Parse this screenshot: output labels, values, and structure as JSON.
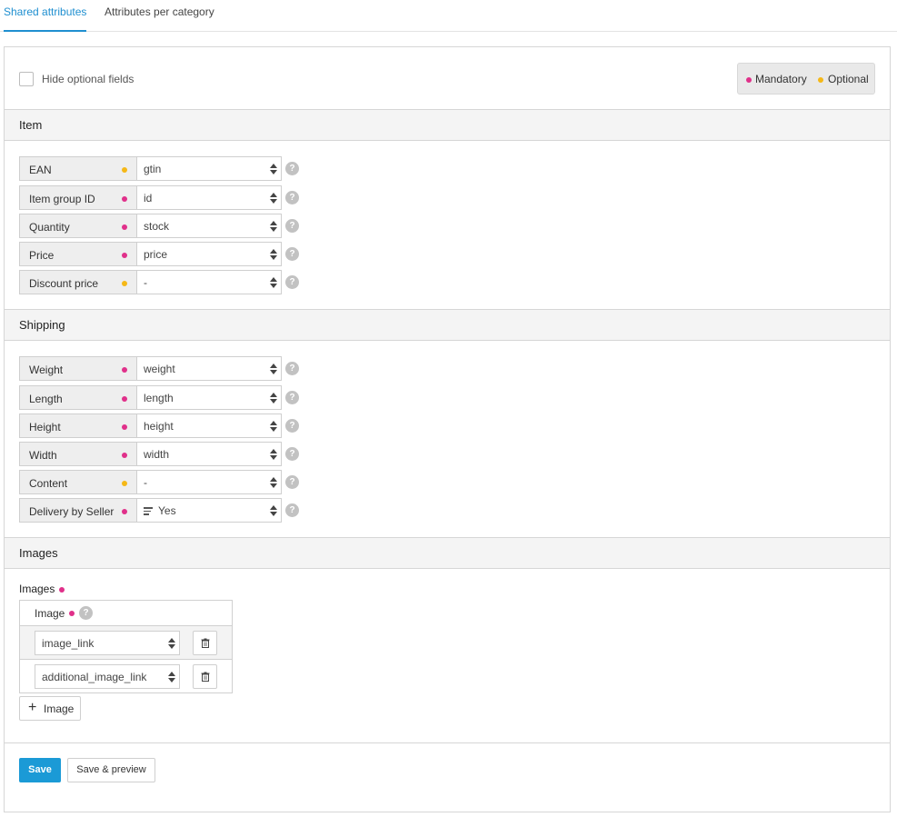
{
  "tabs": [
    {
      "label": "Shared attributes",
      "active": true
    },
    {
      "label": "Attributes per category",
      "active": false
    }
  ],
  "hide_optional": {
    "label": "Hide optional fields",
    "checked": false
  },
  "legend": {
    "mandatory": "Mandatory",
    "optional": "Optional"
  },
  "colors": {
    "mandatory": "#e0308a",
    "optional": "#f5b817",
    "accent": "#1b9ad6"
  },
  "sections": {
    "item": {
      "title": "Item",
      "rows": [
        {
          "label": "EAN",
          "status": "optional",
          "value": "gtin"
        },
        {
          "label": "Item group ID",
          "status": "mandatory",
          "value": "id"
        },
        {
          "label": "Quantity",
          "status": "mandatory",
          "value": "stock"
        },
        {
          "label": "Price",
          "status": "mandatory",
          "value": "price"
        },
        {
          "label": "Discount price",
          "status": "optional",
          "value": "-"
        }
      ]
    },
    "shipping": {
      "title": "Shipping",
      "rows": [
        {
          "label": "Weight",
          "status": "mandatory",
          "value": "weight"
        },
        {
          "label": "Length",
          "status": "mandatory",
          "value": "length"
        },
        {
          "label": "Height",
          "status": "mandatory",
          "value": "height"
        },
        {
          "label": "Width",
          "status": "mandatory",
          "value": "width"
        },
        {
          "label": "Content",
          "status": "optional",
          "value": "-"
        },
        {
          "label": "Delivery by Seller",
          "status": "mandatory",
          "value": "Yes",
          "icon": "text-lines-icon"
        }
      ]
    },
    "images": {
      "title": "Images",
      "group_label": "Images",
      "column_label": "Image",
      "rows": [
        {
          "value": "image_link"
        },
        {
          "value": "additional_image_link"
        }
      ],
      "add_label": "Image"
    }
  },
  "footer": {
    "save": "Save",
    "save_preview": "Save & preview"
  }
}
